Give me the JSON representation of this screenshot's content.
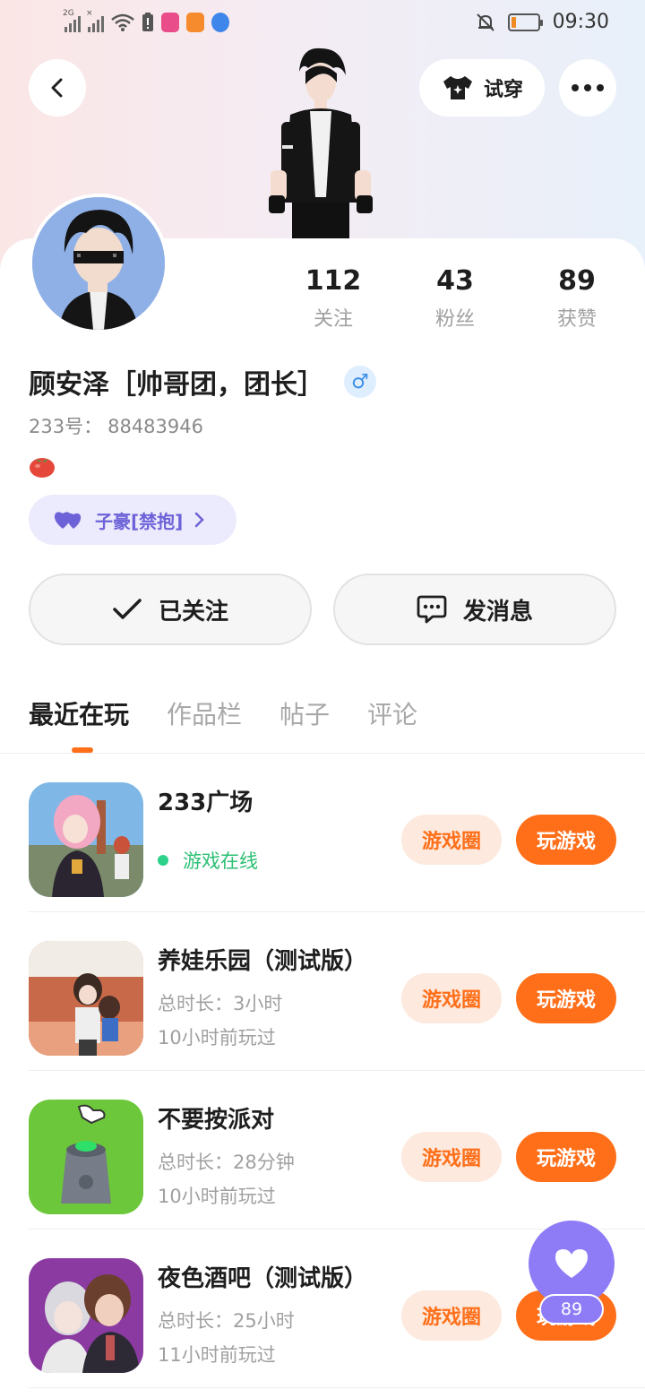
{
  "status_bar": {
    "network_label": "2G",
    "time": "09:30",
    "battery_level": 0.18,
    "colors": {
      "battery": "#f08a22"
    },
    "icons": [
      "signal-icon",
      "signal-x-icon",
      "wifi-icon",
      "battery-alert-icon",
      "app-icon-pink",
      "app-icon-orange",
      "app-icon-blue",
      "mute-bell-icon",
      "battery-icon"
    ]
  },
  "header": {
    "back_icon": "chevron-left-icon",
    "tryon_label": "试穿",
    "tryon_icon": "shirt-sparkle-icon",
    "more_icon": "more-dots-icon"
  },
  "profile": {
    "stats": [
      {
        "num": "112",
        "label": "关注"
      },
      {
        "num": "43",
        "label": "粉丝"
      },
      {
        "num": "89",
        "label": "获赞"
      }
    ],
    "name": "顾安泽［帅哥团，团长］",
    "gender_symbol": "♂",
    "uid_label": "233号：",
    "uid_value": "88483946",
    "emoji_icon": "tomato-icon",
    "tag_label": "子豪[禁抱]",
    "tag_icon": "double-heart-icon",
    "colors": {
      "accent": "#ff6f1a",
      "tag": "#6d62d7",
      "tag_bg": "#ecebfd"
    }
  },
  "actions": {
    "follow_label": "已关注",
    "message_label": "发消息"
  },
  "tabs": [
    "最近在玩",
    "作品栏",
    "帖子",
    "评论"
  ],
  "games": [
    {
      "title": "233广场",
      "line1": "游戏在线",
      "line2": "",
      "online": true,
      "circle_label": "游戏圈",
      "play_label": "玩游戏"
    },
    {
      "title": "养娃乐园（测试版）",
      "line1": "总时长：3小时",
      "line2": "10小时前玩过",
      "online": false,
      "circle_label": "游戏圈",
      "play_label": "玩游戏"
    },
    {
      "title": "不要按派对",
      "line1": "总时长：28分钟",
      "line2": "10小时前玩过",
      "online": false,
      "circle_label": "游戏圈",
      "play_label": "玩游戏"
    },
    {
      "title": "夜色酒吧（测试版）",
      "line1": "总时长：25小时",
      "line2": "11小时前玩过",
      "online": false,
      "circle_label": "游戏圈",
      "play_label": "玩游戏"
    }
  ],
  "floating_like": {
    "count": "89",
    "icon": "heart-icon"
  }
}
